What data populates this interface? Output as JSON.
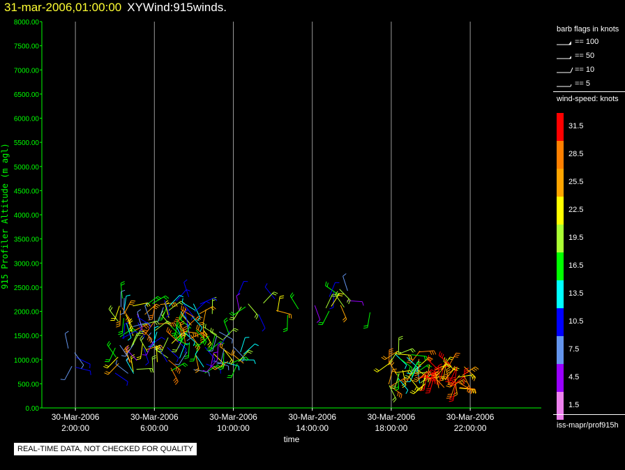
{
  "header": {
    "timestamp": "31-mar-2006,01:00:00",
    "name": "XYWind:915winds."
  },
  "notice": "REAL-TIME DATA, NOT CHECKED FOR QUALITY",
  "legend": {
    "barb_title": "barb flags in knots",
    "barbs": [
      {
        "label": "== 100",
        "kind": "flag"
      },
      {
        "label": "== 50",
        "kind": "flag50"
      },
      {
        "label": "== 10",
        "kind": "full"
      },
      {
        "label": "== 5",
        "kind": "half"
      }
    ],
    "speed_title": "wind-speed: knots",
    "bands": [
      {
        "label": "31.5",
        "color": "#ff0000"
      },
      {
        "label": "28.5",
        "color": "#ff8000"
      },
      {
        "label": "25.5",
        "color": "#ffa500"
      },
      {
        "label": "22.5",
        "color": "#ffff00"
      },
      {
        "label": "19.5",
        "color": "#aaff33"
      },
      {
        "label": "16.5",
        "color": "#00ff00"
      },
      {
        "label": "13.5",
        "color": "#00ffff"
      },
      {
        "label": "10.5",
        "color": "#0000ff"
      },
      {
        "label": "7.5",
        "color": "#6495ed"
      },
      {
        "label": "4.5",
        "color": "#9900ff"
      },
      {
        "label": "1.5",
        "color": "#ee82ee"
      }
    ],
    "source": "iss-mapr/prof915h"
  },
  "chart_data": {
    "type": "scatter",
    "xlabel": "time",
    "ylabel": "915 Profiler Altitude (m agl)",
    "xlim": [
      0.3,
      25.6
    ],
    "ylim": [
      0,
      8000
    ],
    "grid": "vertical",
    "x_ticks": [
      {
        "x": 2,
        "date": "30-Mar-2006",
        "time": "2:00:00"
      },
      {
        "x": 6,
        "date": "30-Mar-2006",
        "time": "6:00:00"
      },
      {
        "x": 10,
        "date": "30-Mar-2006",
        "time": "10:00:00"
      },
      {
        "x": 14,
        "date": "30-Mar-2006",
        "time": "14:00:00"
      },
      {
        "x": 18,
        "date": "30-Mar-2006",
        "time": "18:00:00"
      },
      {
        "x": 22,
        "date": "30-Mar-2006",
        "time": "22:00:00"
      }
    ],
    "y_ticks": [
      "0.00",
      "500.00",
      "1000.00",
      "1500.00",
      "2000.00",
      "2500.00",
      "3000.00",
      "3500.00",
      "4000.00",
      "4500.00",
      "5000.00",
      "5500.00",
      "6000.00",
      "6500.00",
      "7000.00",
      "7500.00",
      "8000.00"
    ],
    "clusters": [
      {
        "x_range": [
          4.0,
          9.0
        ],
        "alt_range": [
          700,
          2300
        ],
        "speed_range": [
          5,
          30
        ],
        "count": 130
      },
      {
        "x_range": [
          1.5,
          2.2
        ],
        "alt_range": [
          600,
          1500
        ],
        "speed_range": [
          5,
          12
        ],
        "count": 5
      },
      {
        "x_range": [
          9.0,
          10.8
        ],
        "alt_range": [
          900,
          1600
        ],
        "speed_range": [
          4,
          25
        ],
        "count": 25
      },
      {
        "x_range": [
          10.0,
          17.0
        ],
        "alt_range": [
          1900,
          2500
        ],
        "speed_range": [
          4,
          25
        ],
        "count": 25
      },
      {
        "x_range": [
          17.8,
          19.5
        ],
        "alt_range": [
          400,
          1200
        ],
        "speed_range": [
          13,
          30
        ],
        "count": 35
      },
      {
        "x_range": [
          19.3,
          21.8
        ],
        "alt_range": [
          400,
          900
        ],
        "speed_range": [
          22,
          34
        ],
        "count": 45
      }
    ]
  }
}
